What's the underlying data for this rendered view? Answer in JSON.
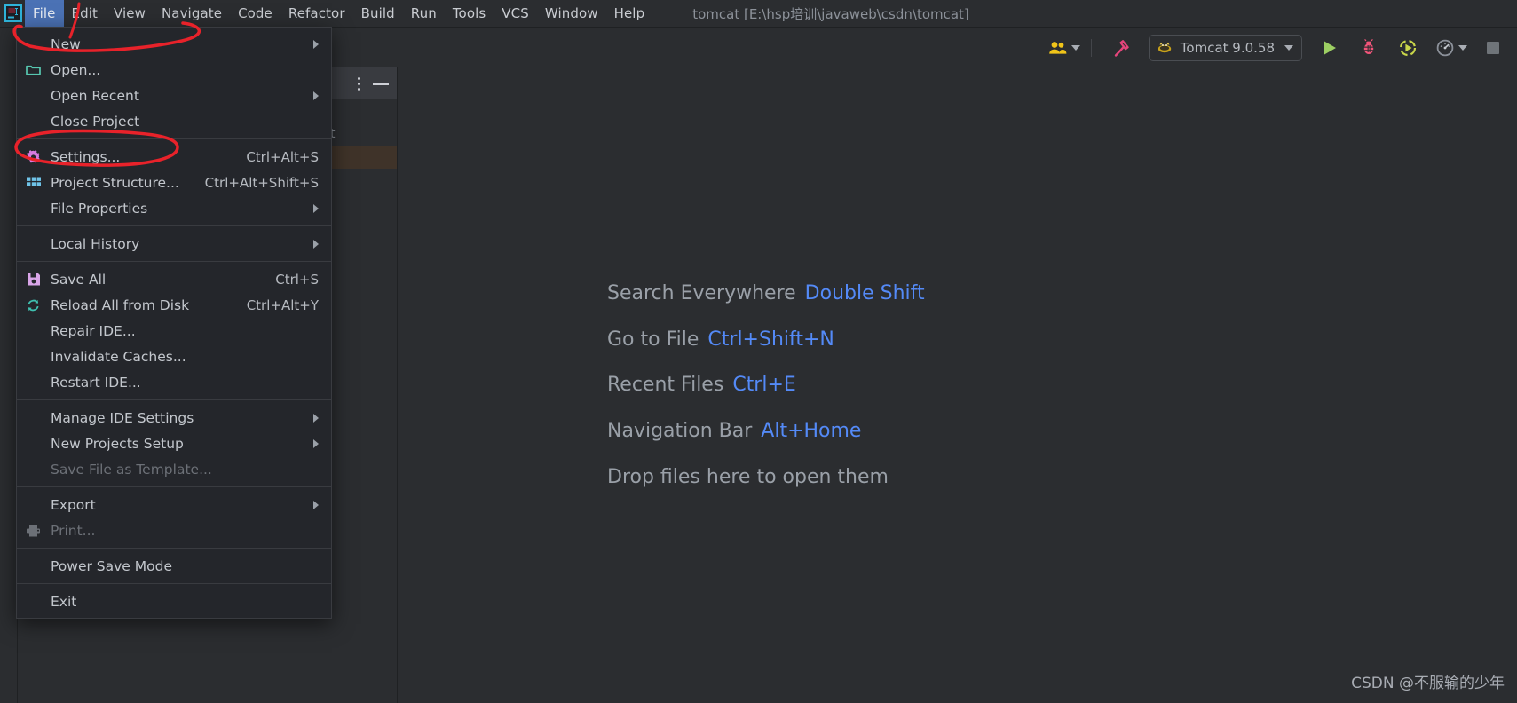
{
  "window": {
    "title": "tomcat [E:\\hsp培训\\javaweb\\csdn\\tomcat]"
  },
  "menubar": {
    "items": [
      {
        "label": "File",
        "mnemonic": "F",
        "active": true
      },
      {
        "label": "Edit",
        "mnemonic": "E",
        "active": false
      },
      {
        "label": "View",
        "mnemonic": "V",
        "active": false
      },
      {
        "label": "Navigate",
        "mnemonic": "N",
        "active": false
      },
      {
        "label": "Code",
        "mnemonic": "C",
        "active": false
      },
      {
        "label": "Refactor",
        "mnemonic": "R",
        "active": false
      },
      {
        "label": "Build",
        "mnemonic": "B",
        "active": false
      },
      {
        "label": "Run",
        "mnemonic": "R",
        "active": false
      },
      {
        "label": "Tools",
        "mnemonic": "T",
        "active": false
      },
      {
        "label": "VCS",
        "mnemonic": "S",
        "active": false
      },
      {
        "label": "Window",
        "mnemonic": "W",
        "active": false
      },
      {
        "label": "Help",
        "mnemonic": "H",
        "active": false
      }
    ]
  },
  "toolbar": {
    "collaborate_icon": "people-icon",
    "build_icon": "hammer-icon",
    "run_config": {
      "icon": "tomcat-icon",
      "label": "Tomcat 9.0.58",
      "dropdown_icon": "chevron-down-icon"
    },
    "run_icon": "run-play-icon",
    "debug_icon": "debug-bug-icon",
    "run_with_coverage_icon": "run-coverage-icon",
    "profiler_icon": "profiler-gauge-icon",
    "profiler_dropdown_icon": "chevron-down-icon",
    "stop_icon": "stop-square-icon"
  },
  "project_panel": {
    "kebab_icon": "more-options-icon",
    "minimize_icon": "minimize-icon",
    "rows": [
      {
        "text": ""
      },
      {
        "text": "t"
      },
      {
        "text": ""
      }
    ]
  },
  "file_menu": {
    "groups": [
      {
        "items": [
          {
            "label": "New",
            "mnemonic": "N",
            "icon": null,
            "shortcut": null,
            "submenu": true,
            "disabled": false
          },
          {
            "label": "Open...",
            "mnemonic": "O",
            "icon": "folder-icon",
            "shortcut": null,
            "submenu": false,
            "disabled": false
          },
          {
            "label": "Open Recent",
            "mnemonic": "R",
            "icon": null,
            "shortcut": null,
            "submenu": true,
            "disabled": false
          },
          {
            "label": "Close Project",
            "mnemonic": null,
            "icon": null,
            "shortcut": null,
            "submenu": false,
            "disabled": false
          }
        ]
      },
      {
        "items": [
          {
            "label": "Settings...",
            "mnemonic": "t",
            "icon": "gear-icon",
            "shortcut": "Ctrl+Alt+S",
            "submenu": false,
            "disabled": false
          },
          {
            "label": "Project Structure...",
            "mnemonic": null,
            "icon": "modules-grid-icon",
            "shortcut": "Ctrl+Alt+Shift+S",
            "submenu": false,
            "disabled": false
          },
          {
            "label": "File Properties",
            "mnemonic": null,
            "icon": null,
            "shortcut": null,
            "submenu": true,
            "disabled": false
          }
        ]
      },
      {
        "items": [
          {
            "label": "Local History",
            "mnemonic": "H",
            "icon": null,
            "shortcut": null,
            "submenu": true,
            "disabled": false
          }
        ]
      },
      {
        "items": [
          {
            "label": "Save All",
            "mnemonic": "S",
            "icon": "save-disk-icon",
            "shortcut": "Ctrl+S",
            "submenu": false,
            "disabled": false
          },
          {
            "label": "Reload All from Disk",
            "mnemonic": null,
            "icon": "reload-icon",
            "shortcut": "Ctrl+Alt+Y",
            "submenu": false,
            "disabled": false
          },
          {
            "label": "Repair IDE...",
            "mnemonic": null,
            "icon": null,
            "shortcut": null,
            "submenu": false,
            "disabled": false
          },
          {
            "label": "Invalidate Caches...",
            "mnemonic": null,
            "icon": null,
            "shortcut": null,
            "submenu": false,
            "disabled": false
          },
          {
            "label": "Restart IDE...",
            "mnemonic": null,
            "icon": null,
            "shortcut": null,
            "submenu": false,
            "disabled": false
          }
        ]
      },
      {
        "items": [
          {
            "label": "Manage IDE Settings",
            "mnemonic": null,
            "icon": null,
            "shortcut": null,
            "submenu": true,
            "disabled": false
          },
          {
            "label": "New Projects Setup",
            "mnemonic": null,
            "icon": null,
            "shortcut": null,
            "submenu": true,
            "disabled": false
          },
          {
            "label": "Save File as Template...",
            "mnemonic": "l",
            "icon": null,
            "shortcut": null,
            "submenu": false,
            "disabled": true
          }
        ]
      },
      {
        "items": [
          {
            "label": "Export",
            "mnemonic": null,
            "icon": null,
            "shortcut": null,
            "submenu": true,
            "disabled": false
          },
          {
            "label": "Print...",
            "mnemonic": "P",
            "icon": "printer-icon",
            "shortcut": null,
            "submenu": false,
            "disabled": true
          }
        ]
      },
      {
        "items": [
          {
            "label": "Power Save Mode",
            "mnemonic": null,
            "icon": null,
            "shortcut": null,
            "submenu": false,
            "disabled": false
          }
        ]
      },
      {
        "items": [
          {
            "label": "Exit",
            "mnemonic": "E",
            "icon": null,
            "shortcut": null,
            "submenu": false,
            "disabled": false
          }
        ]
      }
    ]
  },
  "editor_hints": [
    {
      "label": "Search Everywhere",
      "key": "Double Shift"
    },
    {
      "label": "Go to File",
      "key": "Ctrl+Shift+N"
    },
    {
      "label": "Recent Files",
      "key": "Ctrl+E"
    },
    {
      "label": "Navigation Bar",
      "key": "Alt+Home"
    },
    {
      "label": "Drop files here to open them",
      "key": ""
    }
  ],
  "watermark": "CSDN @不服输的少年",
  "colors": {
    "bg": "#2b2d30",
    "menu_popup_bg": "#24262b",
    "menu_active": "#4b72b5",
    "hint_key": "#548af7",
    "hint_label": "#9aa0a8",
    "annotation": "#e8222a",
    "run_green": "#9dcf63",
    "debug_red": "#f2557a",
    "people_yellow": "#f0c419",
    "gear_purple": "#d87ae0"
  }
}
